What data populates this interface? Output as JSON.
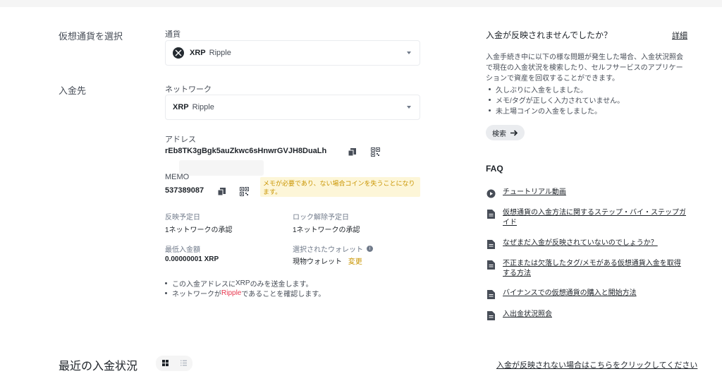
{
  "left": {
    "select_crypto_label": "仮想通貨を選択",
    "deposit_to_label": "入金先",
    "currency_label": "通貨",
    "currency": {
      "symbol": "XRP",
      "name": "Ripple"
    },
    "network_label": "ネットワーク",
    "network": {
      "symbol": "XRP",
      "name": "Ripple"
    },
    "address_label": "アドレス",
    "address": "rEb8TK3gBgk5auZkwc6sHnwrGVJH8DuaLh",
    "memo_label": "MEMO",
    "memo": "537389087",
    "memo_warning": "メモが必要であり、ない場合コインを失うことになります。",
    "info": {
      "arrival_label": "反映予定日",
      "arrival_value": "1ネットワークの承認",
      "unlock_label": "ロック解除予定日",
      "unlock_value": "1ネットワークの承認",
      "min_label": "最低入金額",
      "min_value": "0.00000001 XRP",
      "wallet_label": "選択されたウォレット",
      "wallet_value": "現物ウォレット",
      "wallet_change": "変更"
    },
    "notes": {
      "n1_pre": "この入金アドレスに",
      "n1_hl": "XRP",
      "n1_post": "のみを送金します。",
      "n2_pre": "ネットワークが",
      "n2_hl": "Ripple",
      "n2_post": "であることを確認します。"
    }
  },
  "right": {
    "title": "入金が反映されませんでしたか？",
    "details_link": "詳細",
    "description": "入金手続き中に以下の様な問題が発生した場合、入金状況照会で現在の入金状況を検索したり、セルフサービスのアプリケーションで資産を回収することができます。",
    "bullets": [
      "久しぶりに入金をしました。",
      "メモ/タグが正しく入力されていません。",
      "未上場コインの入金をしました。"
    ],
    "search_button": "検索",
    "faq_title": "FAQ",
    "faq": [
      {
        "icon": "play-circle-icon",
        "text": "チュートリアル動画"
      },
      {
        "icon": "document-icon",
        "text": "仮想通貨の入金方法に関するステップ・バイ・ステップガイド"
      },
      {
        "icon": "document-icon",
        "text": "なぜまだ入金が反映されていないのでしょうか？"
      },
      {
        "icon": "document-icon",
        "text": "不正または欠落したタグ/メモがある仮想通貨入金を取得する方法"
      },
      {
        "icon": "document-icon",
        "text": "バイナンスでの仮想通貨の購入と開始方法"
      },
      {
        "icon": "document-icon",
        "text": "入出金状況照会"
      }
    ]
  },
  "footer": {
    "recent_title": "最近の入金状況",
    "not_reflected_link": "入金が反映されない場合はこちらをクリックしてください"
  },
  "colors": {
    "accent": "#c99400",
    "highlight_red": "#e8384f",
    "warning_bg": "#fdf6d8"
  }
}
